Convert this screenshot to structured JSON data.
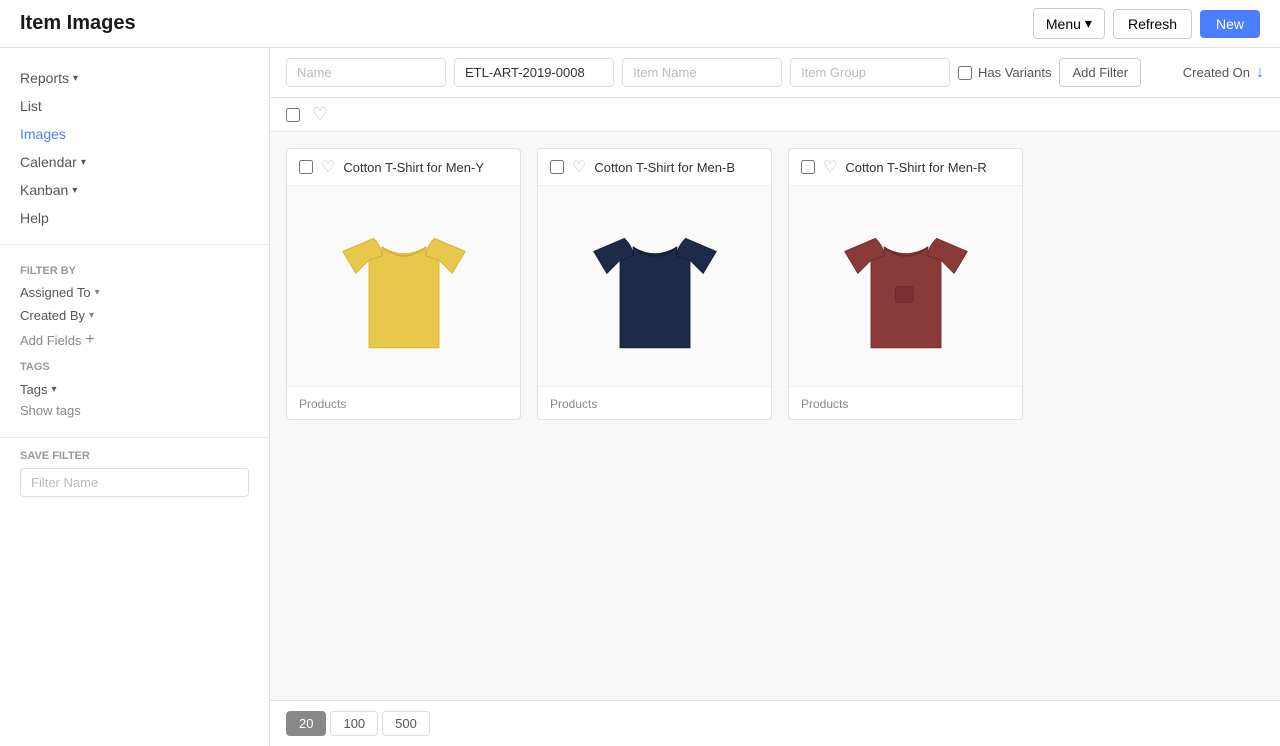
{
  "header": {
    "title": "Item Images",
    "menu_label": "Menu",
    "refresh_label": "Refresh",
    "new_label": "New"
  },
  "sidebar": {
    "nav_items": [
      {
        "id": "reports",
        "label": "Reports",
        "has_caret": true
      },
      {
        "id": "list",
        "label": "List",
        "has_caret": false
      },
      {
        "id": "images",
        "label": "Images",
        "has_caret": false,
        "active": true
      },
      {
        "id": "calendar",
        "label": "Calendar",
        "has_caret": true
      },
      {
        "id": "kanban",
        "label": "Kanban",
        "has_caret": true
      },
      {
        "id": "help",
        "label": "Help",
        "has_caret": false
      }
    ],
    "filter_by_label": "FILTER BY",
    "filters": [
      {
        "id": "assigned-to",
        "label": "Assigned To",
        "has_caret": true
      },
      {
        "id": "created-by",
        "label": "Created By",
        "has_caret": true
      }
    ],
    "add_fields_label": "Add Fields",
    "tags_label": "TAGS",
    "tags_item_label": "Tags",
    "show_tags_label": "Show tags",
    "save_filter_label": "SAVE FILTER",
    "filter_name_placeholder": "Filter Name"
  },
  "filters": {
    "name_placeholder": "Name",
    "item_code_value": "ETL-ART-2019-0008",
    "item_name_placeholder": "Item Name",
    "item_group_placeholder": "Item Group",
    "has_variants_label": "Has Variants",
    "add_filter_label": "Add Filter",
    "sort_label": "Created On"
  },
  "items": [
    {
      "id": "item-1",
      "title": "Cotton T-Shirt for Men-Y",
      "category": "Products",
      "color": "yellow"
    },
    {
      "id": "item-2",
      "title": "Cotton T-Shirt for Men-B",
      "category": "Products",
      "color": "navy"
    },
    {
      "id": "item-3",
      "title": "Cotton T-Shirt for Men-R",
      "category": "Products",
      "color": "red"
    }
  ],
  "pagination": {
    "options": [
      "20",
      "100",
      "500"
    ],
    "active": "20"
  }
}
